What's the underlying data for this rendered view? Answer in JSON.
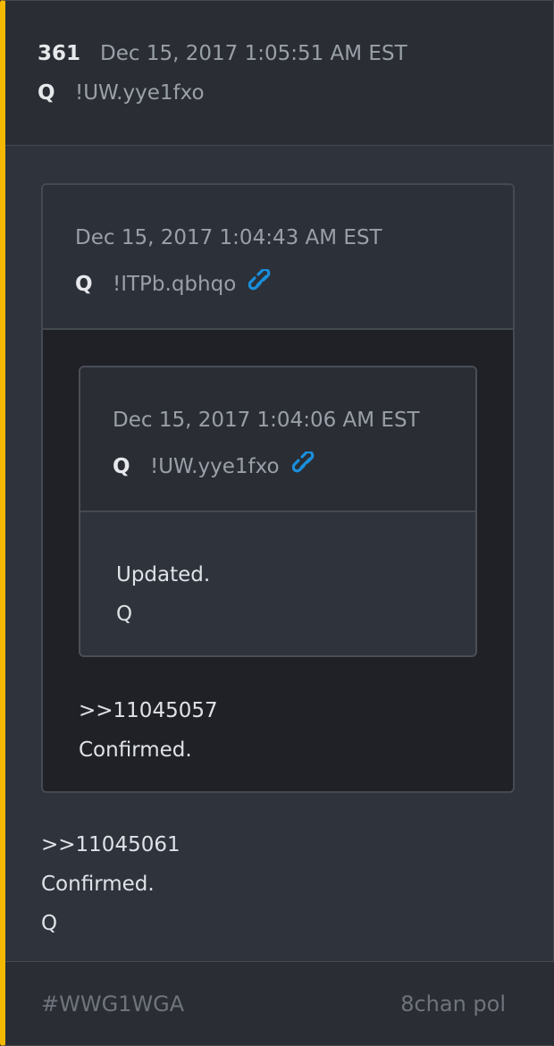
{
  "post": {
    "number": "361",
    "date": "Dec 15, 2017 1:05:51 AM EST",
    "author": "Q",
    "trip": "!UW.yye1fxo",
    "accent_color": "#f5b800"
  },
  "quote1": {
    "date": "Dec 15, 2017 1:04:43 AM EST",
    "author": "Q",
    "trip": "!ITPb.qbhqo",
    "link_icon": "link-icon",
    "text": [
      ">>11045057",
      "Confirmed."
    ]
  },
  "quote2": {
    "date": "Dec 15, 2017 1:04:06 AM EST",
    "author": "Q",
    "trip": "!UW.yye1fxo",
    "link_icon": "link-icon",
    "text": [
      "Updated.",
      "Q"
    ]
  },
  "body_text": [
    ">>11045061",
    "Confirmed.",
    "Q"
  ],
  "footer": {
    "tag": "#WWG1WGA",
    "source": "8chan pol"
  },
  "colors": {
    "link": "#1a8fdc"
  }
}
